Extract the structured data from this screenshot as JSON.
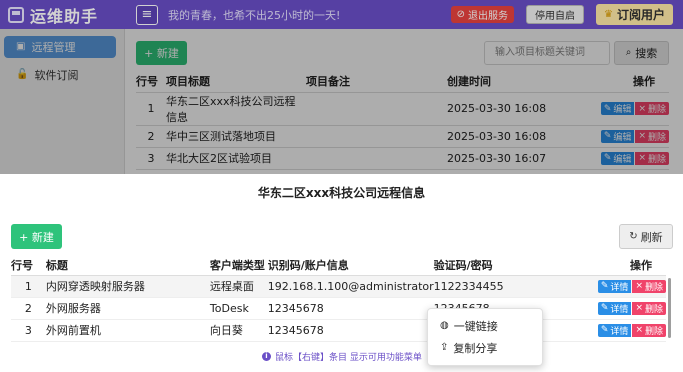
{
  "app": {
    "title": "运维助手",
    "menu_icon": "hamburger-icon",
    "slogan": "我的青春，也希不出25小时的一天!",
    "logout_label": "退出服务",
    "disable_label": "停用自启",
    "vip_label": "订阅用户"
  },
  "sidebar": {
    "items": [
      {
        "label": "远程管理",
        "icon": "monitor-icon"
      },
      {
        "label": "软件订阅",
        "icon": "lock-icon"
      }
    ]
  },
  "main": {
    "add_label": "+ 新建",
    "search_placeholder": "输入项目标题关键词",
    "search_label": "搜索",
    "columns": [
      "行号",
      "项目标题",
      "项目备注",
      "创建时间",
      "操作"
    ],
    "rows": [
      {
        "no": "1",
        "title": "华东二区xxx科技公司远程信息",
        "note": "",
        "time": "2025-03-30 16:08"
      },
      {
        "no": "2",
        "title": "华中三区测试落地项目",
        "note": "",
        "time": "2025-03-30 16:08"
      },
      {
        "no": "3",
        "title": "华北大区2区试验项目",
        "note": "",
        "time": "2025-03-30 16:07"
      }
    ],
    "edit_label": "编辑",
    "delete_label": "删除"
  },
  "dialog": {
    "title": "华东二区xxx科技公司远程信息",
    "add_label": "+ 新建",
    "refresh_label": "刷新",
    "columns": [
      "行号",
      "标题",
      "客户端类型",
      "识别码/账户信息",
      "验证码/密码",
      "操作"
    ],
    "rows": [
      {
        "no": "1",
        "title": "内网穿透映射服务器",
        "type": "远程桌面",
        "id": "192.168.1.100@administrator",
        "pwd": "1122334455"
      },
      {
        "no": "2",
        "title": "外网服务器",
        "type": "ToDesk",
        "id": "12345678",
        "pwd": "12345678"
      },
      {
        "no": "3",
        "title": "外网前置机",
        "type": "向日葵",
        "id": "12345678",
        "pwd": ""
      }
    ],
    "detail_label": "详情",
    "delete_label": "删除",
    "hint": "鼠标【右键】条目 显示可用功能菜单"
  },
  "context_menu": {
    "items": [
      {
        "label": "一键链接",
        "icon": "globe-icon"
      },
      {
        "label": "复制分享",
        "icon": "share-icon"
      }
    ]
  },
  "colors": {
    "brand": "#6a4fc7",
    "green": "#2ec37b",
    "blue": "#2a8ee6",
    "red": "#f0436a"
  }
}
